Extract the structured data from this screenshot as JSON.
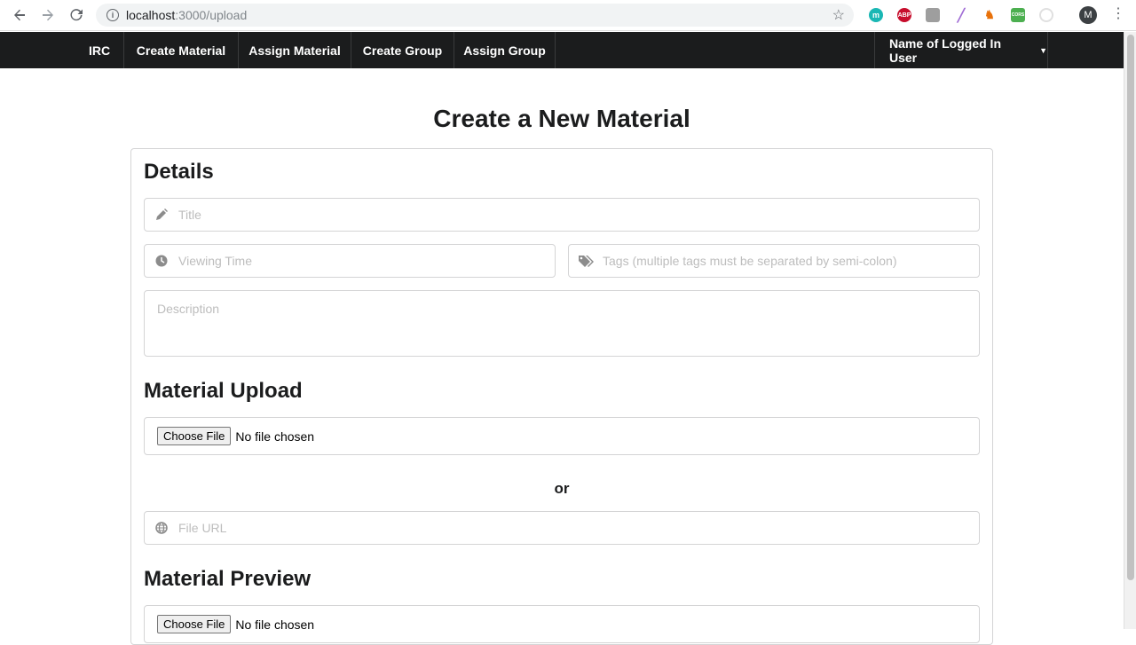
{
  "browser": {
    "url_host": "localhost",
    "url_rest": ":3000/upload",
    "profile_initial": "M",
    "extensions": [
      {
        "name": "m-extension",
        "label": "m",
        "color": "#1ab7b4"
      },
      {
        "name": "adblock-plus",
        "label": "ABP",
        "color": "#c70d2c"
      },
      {
        "name": "gray-extension",
        "label": "",
        "color": "#9e9e9e"
      },
      {
        "name": "pen-extension",
        "label": "",
        "color": "#a06cd5"
      },
      {
        "name": "figure-extension",
        "label": "",
        "color": "#e8710a"
      },
      {
        "name": "cors-extension",
        "label": "CORS",
        "color": "#4caf50"
      },
      {
        "name": "circle-extension",
        "label": "",
        "color": "#e0e0e0"
      }
    ]
  },
  "navbar": {
    "brand": "IRC",
    "items": [
      {
        "label": "Create Material"
      },
      {
        "label": "Assign Material"
      },
      {
        "label": "Create Group"
      },
      {
        "label": "Assign Group"
      }
    ],
    "user": "Name of Logged In User"
  },
  "page": {
    "title": "Create a New Material"
  },
  "details": {
    "heading": "Details",
    "title_placeholder": "Title",
    "viewing_time_placeholder": "Viewing Time",
    "tags_placeholder": "Tags (multiple tags must be separated by semi-colon)",
    "description_placeholder": "Description"
  },
  "upload": {
    "heading": "Material Upload",
    "choose_file": "Choose File",
    "no_file": "No file chosen",
    "or": "or",
    "file_url_placeholder": "File URL"
  },
  "preview": {
    "heading": "Material Preview",
    "choose_file": "Choose File",
    "no_file": "No file chosen"
  }
}
